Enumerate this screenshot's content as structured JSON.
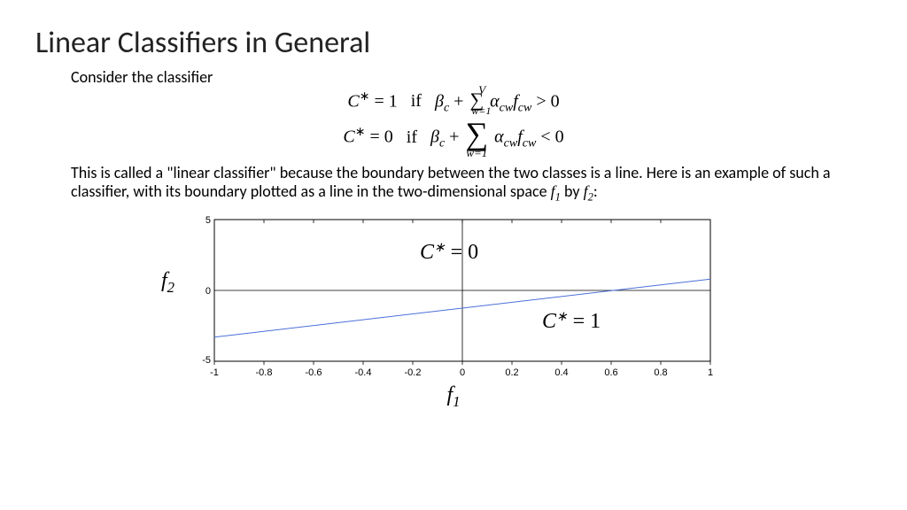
{
  "title": "Linear Classifiers in General",
  "intro": "Consider the classifier",
  "eq1": {
    "lhs_var": "C",
    "lhs_sup": "∗",
    "lhs_val": "1",
    "if": "if",
    "beta_var": "β",
    "beta_sub": "c",
    "plus": "+",
    "sum_lower": "w=1",
    "sum_upper": "V",
    "alpha_var": "α",
    "alpha_sub": "cw",
    "f_var": "f",
    "f_sub": "cw",
    "cmp": ">",
    "zero": "0"
  },
  "eq2": {
    "lhs_var": "C",
    "lhs_sup": "∗",
    "lhs_val": "0",
    "if": "if",
    "beta_var": "β",
    "beta_sub": "c",
    "plus": "+",
    "sum_lower": "w=1",
    "alpha_var": "α",
    "alpha_sub": "cw",
    "f_var": "f",
    "f_sub": "cw",
    "cmp": "<",
    "zero": "0"
  },
  "body_a": "This is called a \"linear classifier\" because the boundary between the two classes is a line.  Here is an example of such a classifier, with its boundary plotted as a line in the two-dimensional space ",
  "body_f1": "f",
  "body_f1_sub": "1",
  "body_by": " by ",
  "body_f2": "f",
  "body_f2_sub": "2",
  "body_colon": ":",
  "chart_data": {
    "type": "line",
    "xlabel": "f₁",
    "ylabel": "f₂",
    "xlim": [
      -1,
      1
    ],
    "ylim": [
      -5,
      5
    ],
    "xticks": [
      -1,
      -0.8,
      -0.6,
      -0.4,
      -0.2,
      0,
      0.2,
      0.4,
      0.6,
      0.8,
      1
    ],
    "yticks": [
      -5,
      0,
      5
    ],
    "series": [
      {
        "name": "boundary",
        "x": [
          -1,
          1
        ],
        "y": [
          -3.3,
          0.8
        ],
        "color": "#4a6fd8"
      }
    ],
    "annotations": [
      {
        "text": "C* = 0",
        "x": -0.12,
        "y": 2.2
      },
      {
        "text": "C* = 1",
        "x": 0.5,
        "y": -2.2
      }
    ]
  },
  "region0": {
    "var": "C",
    "sup": "∗",
    "eq": "=",
    "val": "0"
  },
  "region1": {
    "var": "C",
    "sup": "∗",
    "eq": "=",
    "val": "1"
  },
  "yaxis": {
    "var": "f",
    "sub": "2"
  },
  "xaxis": {
    "var": "f",
    "sub": "1"
  },
  "xtick_labels": [
    "-1",
    "-0.8",
    "-0.6",
    "-0.4",
    "-0.2",
    "0",
    "0.2",
    "0.4",
    "0.6",
    "0.8",
    "1"
  ],
  "ytick_labels": [
    "5",
    "0",
    "-5"
  ]
}
